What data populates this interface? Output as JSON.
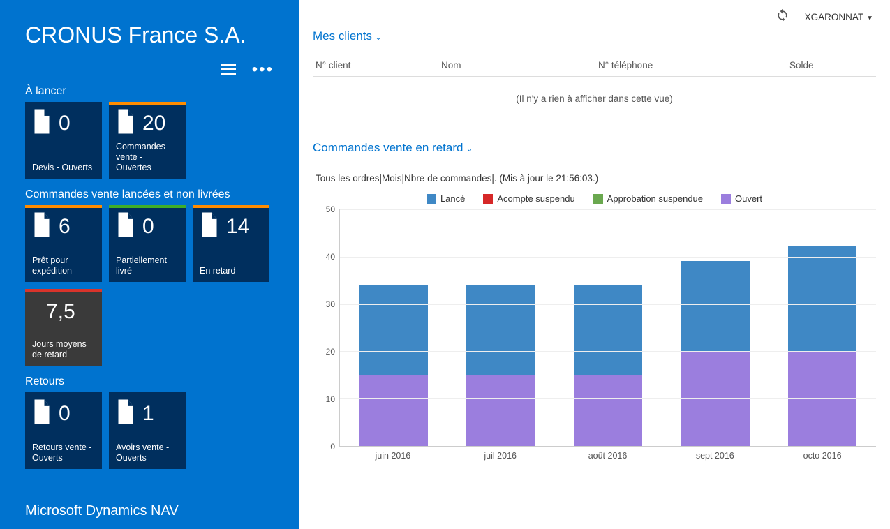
{
  "company": "CRONUS France S.A.",
  "footer": "Microsoft Dynamics NAV",
  "user": "XGARONNAT",
  "sections": {
    "s1_title": "À lancer",
    "s2_title": "Commandes vente lancées et non livrées",
    "s3_title": "Retours"
  },
  "tiles": {
    "devis": {
      "value": "0",
      "label": "Devis - Ouverts"
    },
    "cmd_ouv": {
      "value": "20",
      "label": "Commandes vente - Ouvertes"
    },
    "pret": {
      "value": "6",
      "label": "Prêt pour expédition"
    },
    "partiel": {
      "value": "0",
      "label": "Partiellement livré"
    },
    "retard": {
      "value": "14",
      "label": "En retard"
    },
    "jours": {
      "value": "7,5",
      "label": "Jours moyens de retard"
    },
    "ret_vente": {
      "value": "0",
      "label": "Retours vente - Ouverts"
    },
    "avoirs": {
      "value": "1",
      "label": "Avoirs vente - Ouverts"
    }
  },
  "clients": {
    "title": "Mes clients",
    "cols": {
      "c1": "N° client",
      "c2": "Nom",
      "c3": "N° téléphone",
      "c4": "Solde"
    },
    "empty": "(Il n'y a rien à afficher dans cette vue)"
  },
  "late_orders": {
    "title": "Commandes vente en retard",
    "caption": "Tous les ordres|Mois|Nbre de commandes|. (Mis à jour le 21:56:03.)"
  },
  "colors": {
    "lance": "#3f88c5",
    "acompte": "#d62828",
    "approb": "#6aa84f",
    "ouvert": "#9b7ede"
  },
  "chart_data": {
    "type": "bar",
    "title": "Commandes vente en retard",
    "xlabel": "",
    "ylabel": "",
    "ylim": [
      0,
      50
    ],
    "yticks": [
      0,
      10,
      20,
      30,
      40,
      50
    ],
    "categories": [
      "juin 2016",
      "juil 2016",
      "août 2016",
      "sept 2016",
      "octo 2016"
    ],
    "series": [
      {
        "name": "Lancé",
        "values": [
          19,
          19,
          19,
          19,
          22
        ]
      },
      {
        "name": "Acompte suspendu",
        "values": [
          0,
          0,
          0,
          0,
          0
        ]
      },
      {
        "name": "Approbation suspendue",
        "values": [
          0,
          0,
          0,
          0,
          0
        ]
      },
      {
        "name": "Ouvert",
        "values": [
          15,
          15,
          15,
          20,
          20
        ]
      }
    ]
  }
}
